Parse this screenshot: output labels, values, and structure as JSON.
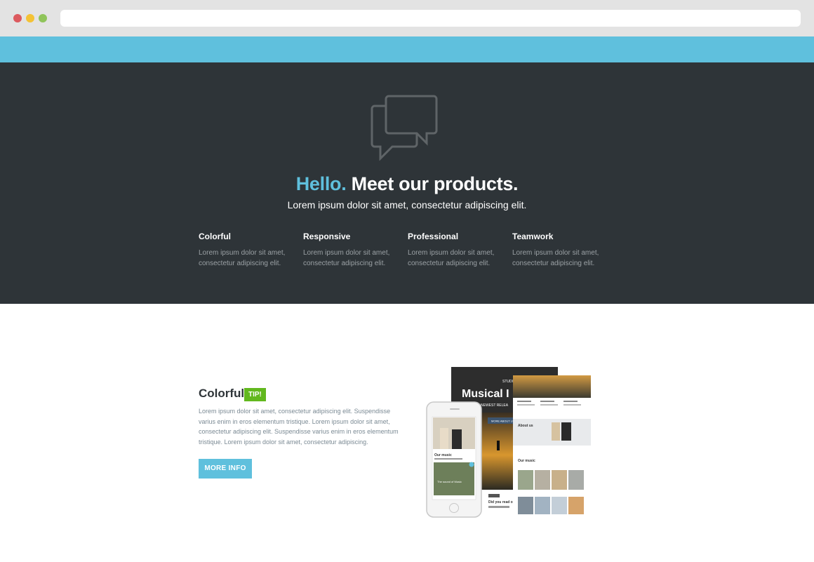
{
  "browser": {
    "address": ""
  },
  "hero": {
    "title_accent": "Hello.",
    "title_rest": " Meet our products.",
    "subtitle": "Lorem ipsum dolor sit amet, consectetur adipiscing elit.",
    "features": [
      {
        "title": "Colorful",
        "text": "Lorem ipsum dolor sit amet, consectetur adipiscing elit."
      },
      {
        "title": "Responsive",
        "text": "Lorem ipsum dolor sit amet, consectetur adipiscing elit."
      },
      {
        "title": "Professional",
        "text": "Lorem ipsum dolor sit amet, consectetur adipiscing elit."
      },
      {
        "title": "Teamwork",
        "text": "Lorem ipsum dolor sit amet, consectetur adipiscing elit."
      }
    ]
  },
  "product": {
    "title": "Colorful",
    "badge": "TIP!",
    "description": "Lorem ipsum dolor sit amet, consectetur adipiscing elit. Suspendisse varius enim in eros elementum tristique. Lorem ipsum dolor sit amet, consectetur adipiscing elit. Suspendisse varius enim in eros elementum tristique. Lorem ipsum dolor sit amet, consectetur adipiscing.",
    "button_label": "MORE INFO",
    "mockup": {
      "studio": "STUDIO",
      "headline": "Musical I",
      "tagline": "R NEWEST RELEA",
      "cta": "MORE ABOUT US",
      "about": "About us",
      "music": "Our music",
      "phone_music": "Our music",
      "phone_caption": "The sound of Music",
      "read": "Did you read o"
    }
  },
  "colors": {
    "accent": "#5fc0dd",
    "dark": "#2e3438",
    "badge": "#62b81e"
  },
  "icons": {
    "hero_icon": "chat-bubbles-icon"
  }
}
